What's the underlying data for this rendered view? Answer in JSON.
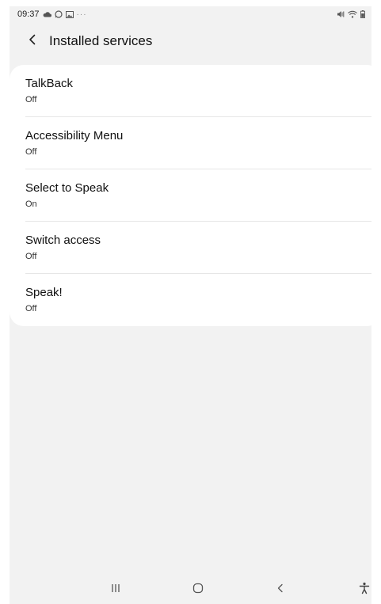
{
  "status_bar": {
    "time": "09:37",
    "overflow": "···",
    "icons": [
      "cloud-icon",
      "whatsapp-icon",
      "gallery-icon",
      "mute-icon",
      "wifi-icon",
      "battery-icon"
    ]
  },
  "header": {
    "title": "Installed services",
    "back_icon": "chevron-left-icon"
  },
  "services": [
    {
      "name": "TalkBack",
      "status": "Off"
    },
    {
      "name": "Accessibility Menu",
      "status": "Off"
    },
    {
      "name": "Select to Speak",
      "status": "On"
    },
    {
      "name": "Switch access",
      "status": "Off"
    },
    {
      "name": "Speak!",
      "status": "Off"
    }
  ],
  "nav_bar": {
    "icons": [
      "recents-icon",
      "home-icon",
      "back-icon",
      "accessibility-icon"
    ]
  },
  "colors": {
    "background": "#f2f2f2",
    "card": "#ffffff",
    "text": "#111111"
  }
}
